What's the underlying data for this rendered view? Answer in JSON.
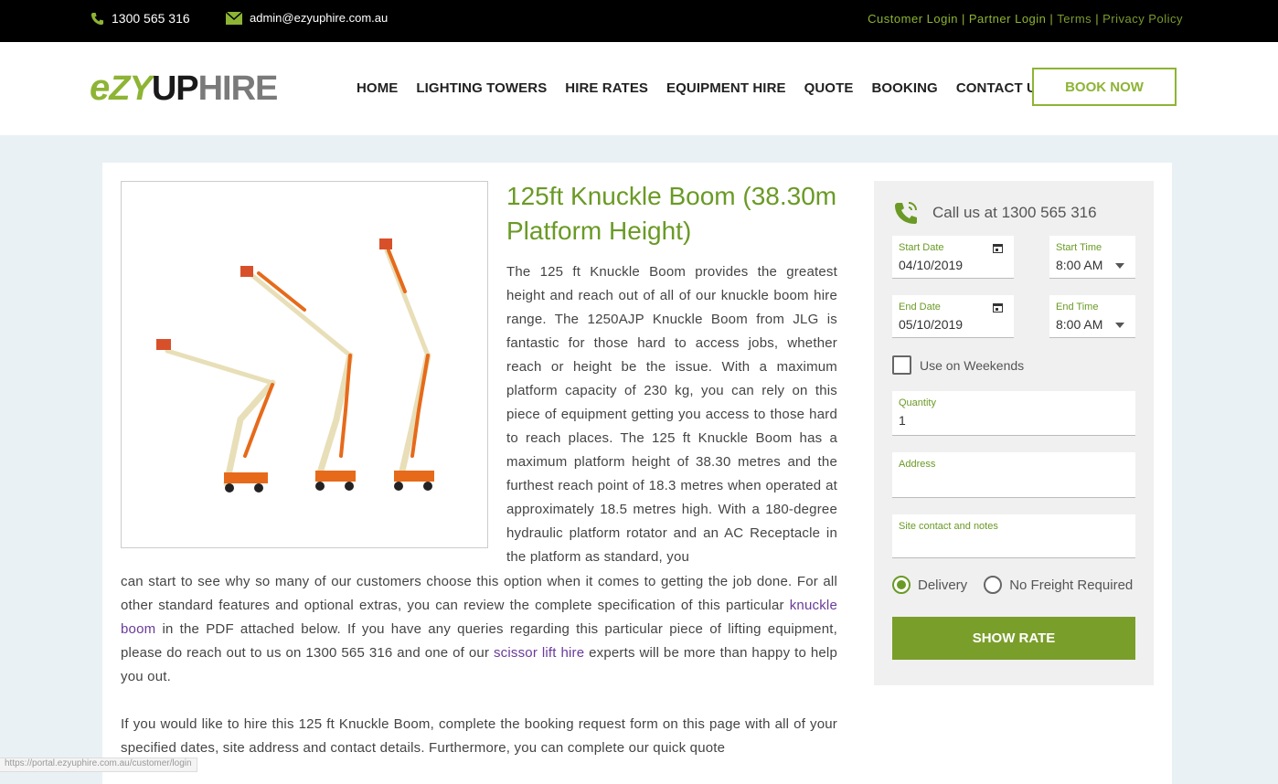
{
  "topbar": {
    "phone": "1300 565 316",
    "email": "admin@ezyuphire.com.au",
    "links": [
      "Customer Login",
      "Partner Login",
      "Terms",
      "Privacy Policy"
    ]
  },
  "header": {
    "logo": {
      "e": "e",
      "zy": "ZY",
      "up": "UP",
      "hire": "HIRE"
    },
    "nav": [
      "HOME",
      "LIGHTING TOWERS",
      "HIRE RATES",
      "EQUIPMENT HIRE",
      "QUOTE",
      "BOOKING",
      "CONTACT US"
    ],
    "book_now": "BOOK NOW"
  },
  "product": {
    "title": "125ft Knuckle Boom (38.30m Platform Height)",
    "desc_narrow": "The 125 ft Knuckle Boom provides the greatest height and reach out of all of our knuckle boom hire range. The 1250AJP Knuckle Boom from JLG is fantastic for those hard to access jobs, whether reach or height be the issue. With a maximum platform capacity of 230 kg, you can rely on this piece of equipment getting you access to those hard to reach places. The 125 ft Knuckle Boom has a maximum platform height of 38.30 metres and the furthest reach point of 18.3 metres when operated at approximately 18.5 metres high. With a 180-degree hydraulic platform rotator and an AC Receptacle in the platform as standard, you",
    "desc_wide_1": "can start to see why so many of our customers choose this option when it comes to getting the job done. For all other standard features and optional extras, you can review the complete specification of this particular",
    "link_knuckle": "knuckle boom",
    "desc_wide_2": " in the PDF attached below. If you have any queries regarding this particular piece of lifting equipment, please do reach out to us on 1300 565 316 and one of our ",
    "link_scissor": "scissor lift hire",
    "desc_wide_3": " experts will be more than happy to help you out.",
    "desc_para2": "If you would like to hire this 125 ft Knuckle Boom, complete the booking request form on this page with all of your specified dates, site address and contact details. Furthermore, you can complete our quick quote"
  },
  "form": {
    "call_text": "Call us at 1300 565 316",
    "start_date": {
      "label": "Start Date",
      "value": "04/10/2019"
    },
    "start_time": {
      "label": "Start Time",
      "value": "8:00 AM"
    },
    "end_date": {
      "label": "End Date",
      "value": "05/10/2019"
    },
    "end_time": {
      "label": "End Time",
      "value": "8:00 AM"
    },
    "weekends": "Use on Weekends",
    "quantity": {
      "label": "Quantity",
      "value": "1"
    },
    "address": {
      "label": "Address",
      "value": ""
    },
    "notes": {
      "label": "Site contact and notes",
      "value": ""
    },
    "delivery": "Delivery",
    "no_freight": "No Freight Required",
    "show_rate": "SHOW RATE"
  },
  "status_url": "https://portal.ezyuphire.com.au/customer/login",
  "colors": {
    "brand_green": "#8db434",
    "title_green": "#6a9a25",
    "button_green": "#7a9e2a"
  }
}
